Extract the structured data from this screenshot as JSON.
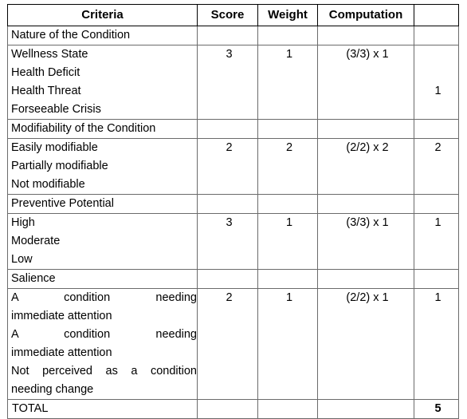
{
  "table": {
    "columns": [
      {
        "key": "criteria",
        "label": "Criteria"
      },
      {
        "key": "score",
        "label": "Score"
      },
      {
        "key": "weight",
        "label": "Weight"
      },
      {
        "key": "computation",
        "label": "Computation"
      },
      {
        "key": "total",
        "label": ""
      }
    ],
    "sections": [
      {
        "heading": "Nature of the Condition",
        "options": [
          "Wellness State",
          "Health Deficit",
          "Health Threat",
          "Forseeable Crisis"
        ],
        "score": "3",
        "weight": "1",
        "computation": "(3/3) x 1",
        "total": "1",
        "value_line": 2,
        "total_line": 3
      },
      {
        "heading": "Modifiability of the Condition",
        "options": [
          "Easily modifiable",
          "Partially modifiable",
          "Not modifiable"
        ],
        "score": "2",
        "weight": "2",
        "computation": "(2/2) x 2",
        "total": "2",
        "value_line": 2,
        "total_line": 2
      },
      {
        "heading": "Preventive Potential",
        "options": [
          "High",
          "Moderate",
          "Low"
        ],
        "score": "3",
        "weight": "1",
        "computation": "(3/3) x 1",
        "total": "1",
        "value_line": 2,
        "total_line": 2
      },
      {
        "heading": "Salience",
        "options": [
          "A condition needing immediate attention",
          "A condition needing immediate attention",
          "Not perceived as a condition needing change"
        ],
        "score": "2",
        "weight": "1",
        "computation": "(2/2) x 1",
        "total": "1",
        "value_line": 2,
        "total_line": 2
      }
    ],
    "total_row": {
      "label": "TOTAL",
      "score": "",
      "weight": "",
      "computation": "",
      "total": "5"
    }
  },
  "salience_lines": {
    "opt1_a": "A condition needing",
    "opt1_b": "immediate attention",
    "opt2_a": "A condition needing",
    "opt2_b": "immediate attention",
    "opt3_a": "Not perceived as a condition",
    "opt3_b": "needing change"
  },
  "colors": {
    "grid": "#6b6b6b",
    "outer": "#000000",
    "text": "#000000",
    "background": "#ffffff"
  }
}
